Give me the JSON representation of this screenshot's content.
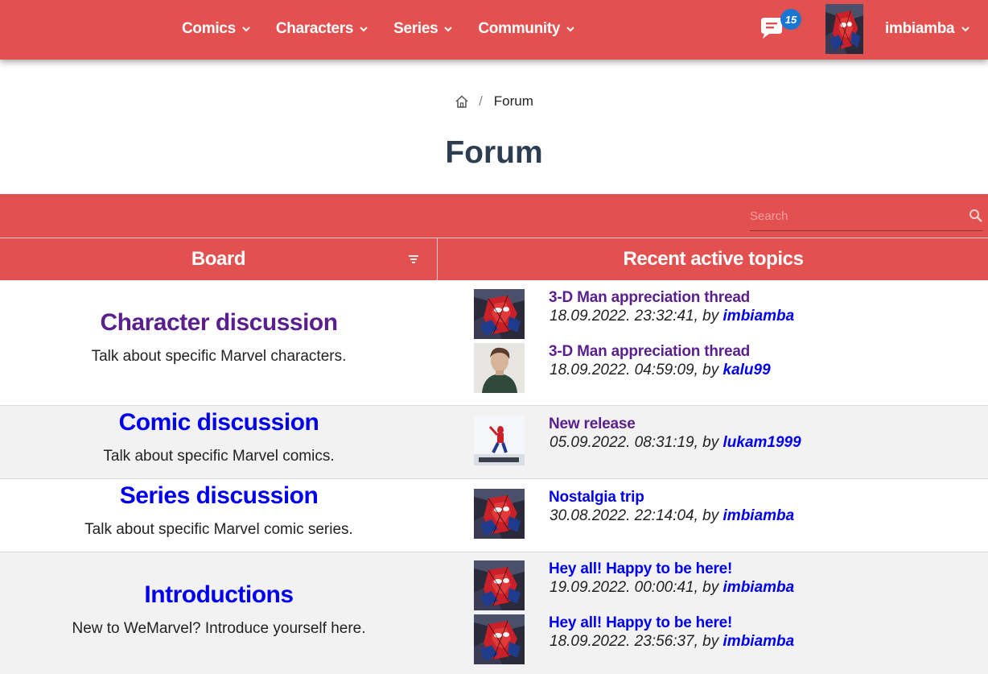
{
  "nav": {
    "items": [
      {
        "label": "Comics"
      },
      {
        "label": "Characters"
      },
      {
        "label": "Series"
      },
      {
        "label": "Community"
      }
    ],
    "messages_count": "15",
    "username": "imbiamba"
  },
  "breadcrumb": {
    "current": "Forum"
  },
  "page": {
    "title": "Forum"
  },
  "forum": {
    "search_placeholder": "Search",
    "headers": {
      "board": "Board",
      "recent": "Recent active topics"
    },
    "boards": [
      {
        "title": "Character discussion",
        "description": "Talk about specific Marvel characters.",
        "topics": [
          {
            "title": "3-D Man appreciation thread",
            "date": "18.09.2022. 23:32:41, by ",
            "author": "imbiamba"
          },
          {
            "title": "3-D Man appreciation thread",
            "date": "18.09.2022. 04:59:09, by ",
            "author": "kalu99"
          }
        ]
      },
      {
        "title": "Comic discussion",
        "description": "Talk about specific Marvel comics.",
        "topics": [
          {
            "title": "New release",
            "date": "05.09.2022. 08:31:19, by ",
            "author": "lukam1999"
          }
        ]
      },
      {
        "title": "Series discussion",
        "description": "Talk about specific Marvel comic series.",
        "topics": [
          {
            "title": "Nostalgia trip",
            "date": "30.08.2022. 22:14:04, by ",
            "author": "imbiamba"
          }
        ]
      },
      {
        "title": "Introductions",
        "description": "New to WeMarvel? Introduce yourself here.",
        "topics": [
          {
            "title": "Hey all! Happy to be here!",
            "date": "19.09.2022. 00:00:41, by ",
            "author": "imbiamba"
          },
          {
            "title": "Hey all! Happy to be here!",
            "date": "18.09.2022. 23:56:37, by ",
            "author": "imbiamba"
          }
        ]
      }
    ]
  },
  "colors": {
    "brand": "#e35050",
    "link": "#0000ee",
    "visited": "#5a1f8c",
    "badge": "#1976d2"
  }
}
